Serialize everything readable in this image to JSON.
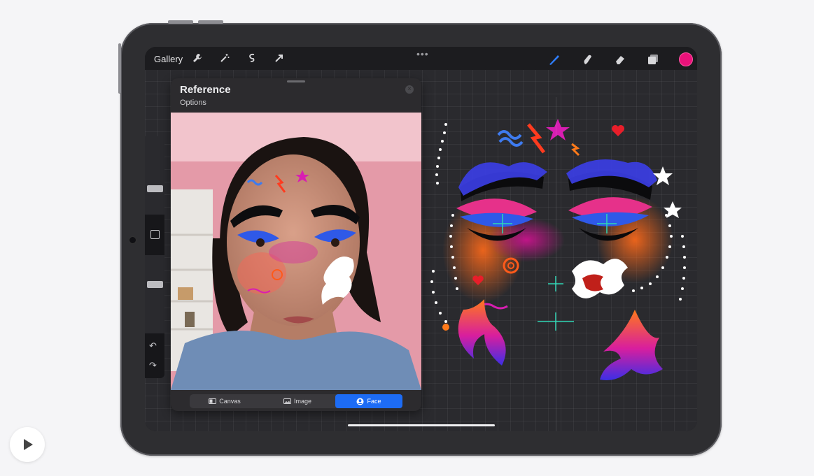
{
  "toolbar": {
    "gallery_label": "Gallery",
    "left_icons": [
      "wrench-icon",
      "magic-wand-icon",
      "selection-icon",
      "transform-arrow-icon"
    ],
    "right_icons": [
      "brush-icon",
      "smudge-icon",
      "eraser-icon",
      "layers-icon"
    ],
    "menu_dots": "•••",
    "current_color": "#e9127a"
  },
  "reference_panel": {
    "title": "Reference",
    "subtitle": "Options",
    "tabs": [
      {
        "label": "Canvas",
        "icon": "canvas-icon",
        "active": false
      },
      {
        "label": "Image",
        "icon": "image-icon",
        "active": false
      },
      {
        "label": "Face",
        "icon": "face-icon",
        "active": true
      }
    ]
  },
  "sidebar": {
    "undo_icon": "↶",
    "redo_icon": "↷"
  },
  "colors": {
    "accent_blue": "#1d6cf5",
    "canvas_bg": "#2a2a2e",
    "device_bezel": "#2e2e31"
  }
}
